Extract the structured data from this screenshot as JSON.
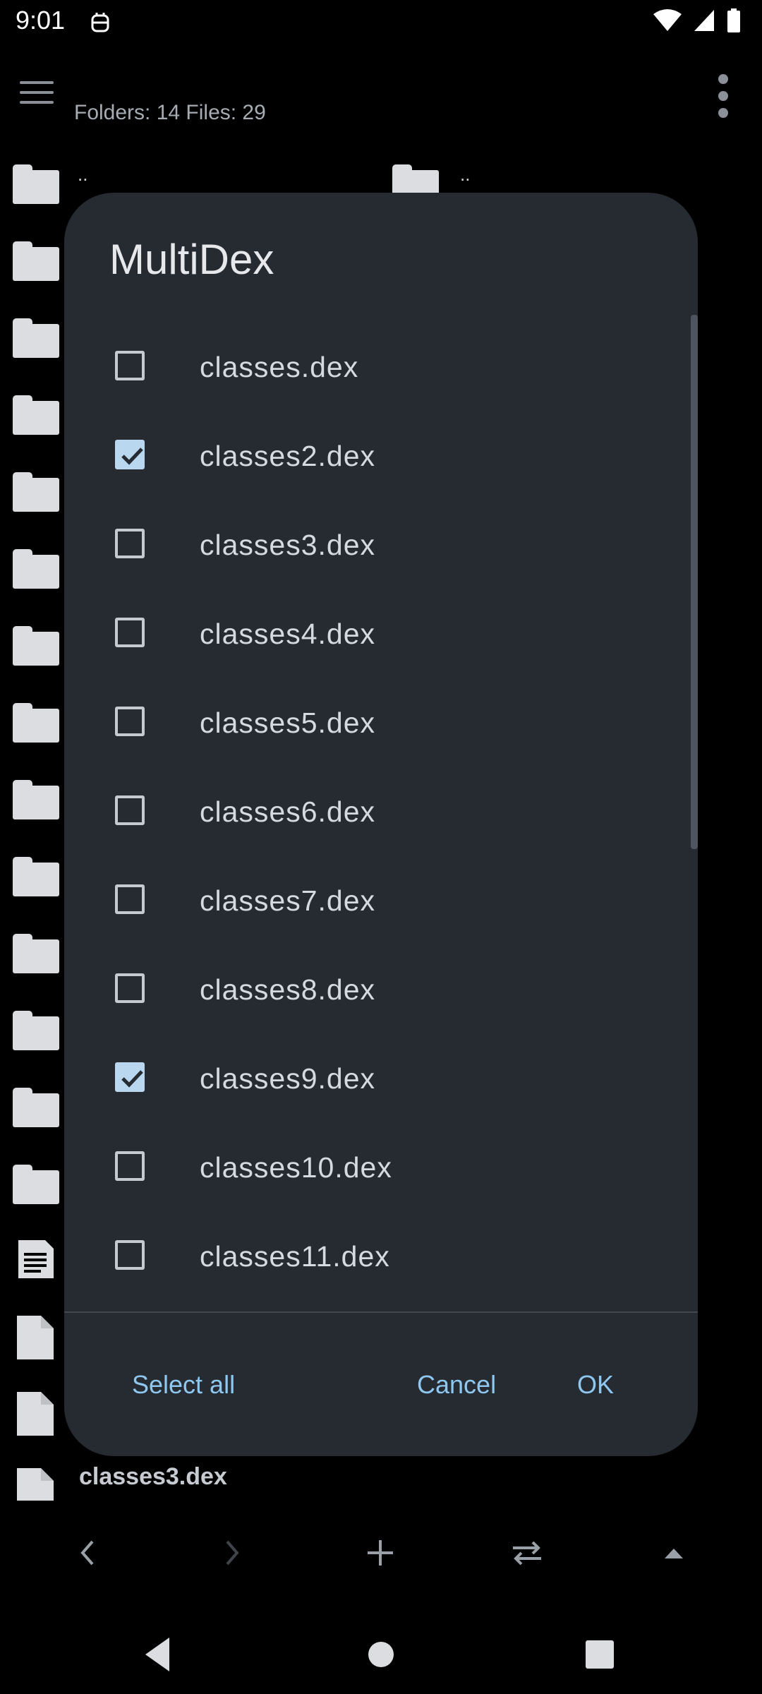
{
  "status_bar": {
    "time": "9:01"
  },
  "background": {
    "counts_text": "Folders: 14 Files: 29",
    "parent_dir_label": "..",
    "partial_file_label": "classes3.dex"
  },
  "dialog": {
    "title": "MultiDex",
    "items": [
      {
        "label": "classes.dex",
        "checked": false
      },
      {
        "label": "classes2.dex",
        "checked": true
      },
      {
        "label": "classes3.dex",
        "checked": false
      },
      {
        "label": "classes4.dex",
        "checked": false
      },
      {
        "label": "classes5.dex",
        "checked": false
      },
      {
        "label": "classes6.dex",
        "checked": false
      },
      {
        "label": "classes7.dex",
        "checked": false
      },
      {
        "label": "classes8.dex",
        "checked": false
      },
      {
        "label": "classes9.dex",
        "checked": true
      },
      {
        "label": "classes10.dex",
        "checked": false
      },
      {
        "label": "classes11.dex",
        "checked": false
      }
    ],
    "buttons": {
      "select_all": "Select all",
      "cancel": "Cancel",
      "ok": "OK"
    }
  },
  "toolbar": {
    "icons": [
      "back-arrow-icon",
      "forward-arrow-icon",
      "add-icon",
      "swap-icon",
      "up-caret-icon"
    ]
  },
  "colors": {
    "dialog_bg": "#262b32",
    "accent": "#8ec8f0",
    "checkbox_checked": "#b9d7ef"
  }
}
